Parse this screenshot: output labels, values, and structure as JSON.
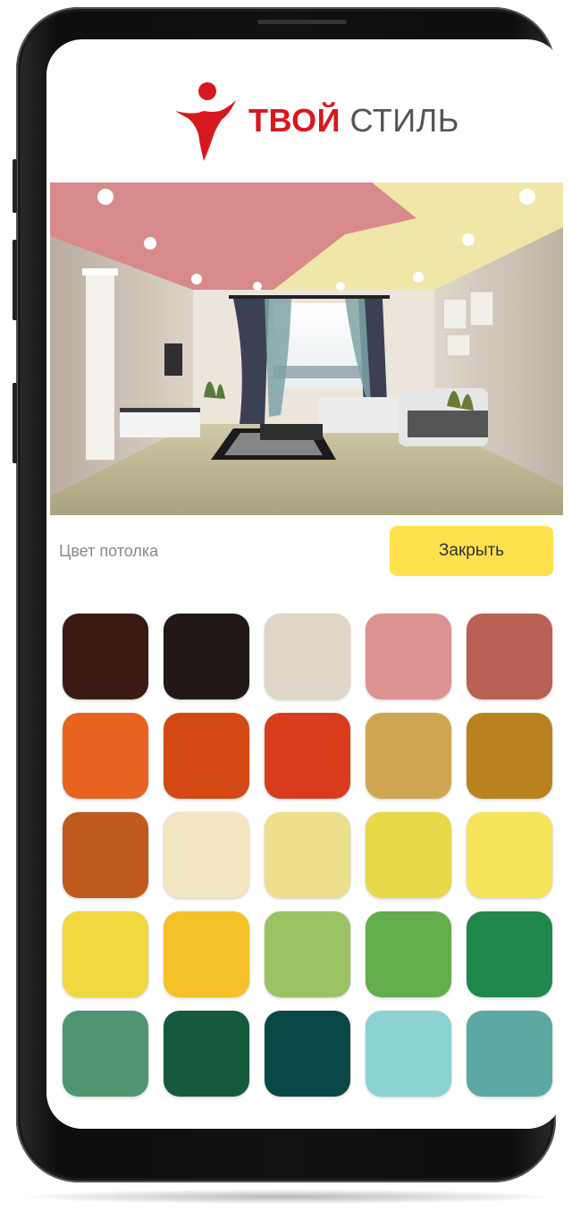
{
  "brand": {
    "name_bold": "ТВОЙ",
    "name_light": "СТИЛЬ",
    "accent_color": "#d7191f"
  },
  "room_image": {
    "icon": "room-interior-illustration",
    "ceiling_color": "#d88a8a",
    "ceiling_secondary_color": "#efe6a8"
  },
  "controls": {
    "label": "Цвет потолка",
    "close_label": "Закрыть",
    "close_color": "#ffe14d"
  },
  "swatches": [
    "#3a1a12",
    "#231818",
    "#e2d6c6",
    "#dc9392",
    "#b86154",
    "#e66420",
    "#d34813",
    "#d83c1c",
    "#d0a652",
    "#b8821f",
    "#c05a1c",
    "#f3e7c2",
    "#ede08c",
    "#e8d84a",
    "#f8e45a",
    "#f1d840",
    "#f4c128",
    "#9ac363",
    "#62ad4c",
    "#1f884a",
    "#4f9572",
    "#165a3e",
    "#0a4747",
    "#8dd2d2",
    "#5ca8a2"
  ]
}
